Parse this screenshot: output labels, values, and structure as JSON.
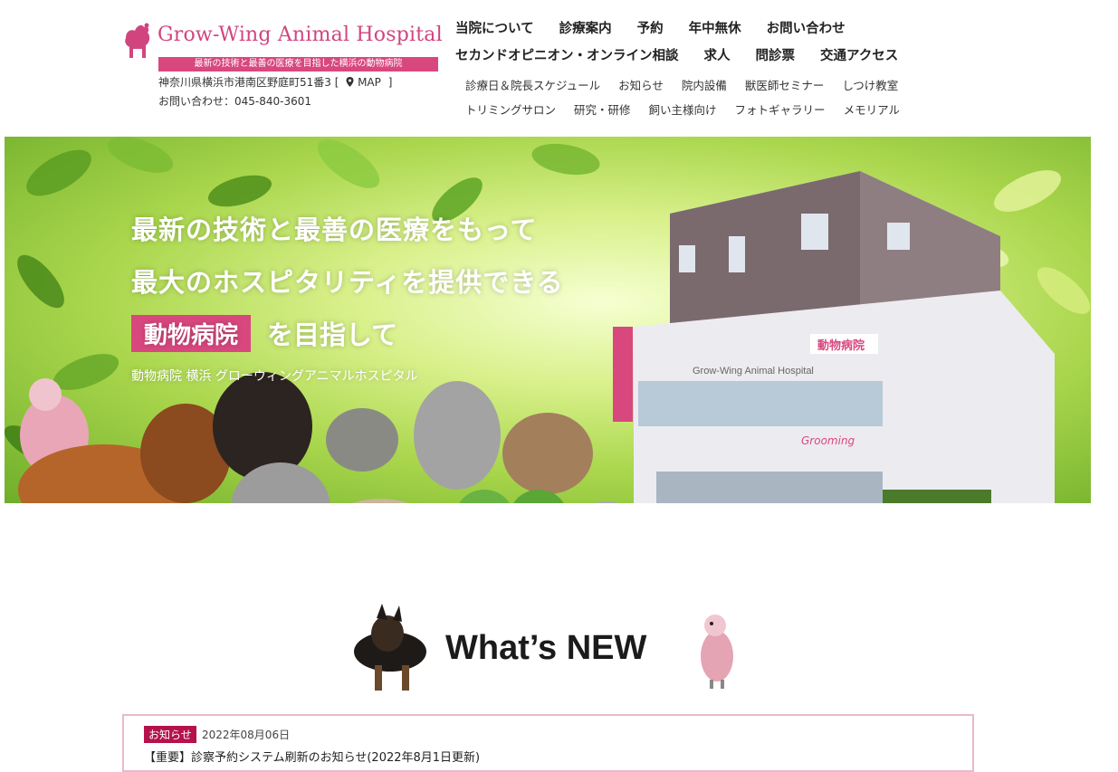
{
  "header": {
    "logo_title": "Grow-Wing Animal Hospital",
    "logo_tagline": "最新の技術と最善の医療を目指した横浜の動物病院",
    "address": "神奈川県横浜市港南区野庭町51番3",
    "map_bracket_open": "[",
    "map_label": "MAP",
    "map_bracket_close": "]",
    "phone": "お問い合わせ：045-840-3601"
  },
  "nav_main": {
    "row1": [
      "当院について",
      "診療案内",
      "予約",
      "年中無休",
      "お問い合わせ"
    ],
    "row2": [
      "セカンドオピニオン・オンライン相談",
      "求人",
      "問診票",
      "交通アクセス"
    ]
  },
  "nav_sub": {
    "row1": [
      "診療日＆院長スケジュール",
      "お知らせ",
      "院内設備",
      "獣医師セミナー",
      "しつけ教室"
    ],
    "row2": [
      "トリミングサロン",
      "研究・研修",
      "飼い主様向け",
      "フォトギャラリー",
      "メモリアル"
    ]
  },
  "hero": {
    "line1": "最新の技術と最善の医療をもって",
    "line2": "最大のホスピタリティを提供できる",
    "badge": "動物病院",
    "line3": "を目指して",
    "sub": "動物病院 横浜 グローウィングアニマルホスピタル",
    "building_sign": "Grow-Wing Animal Hospital",
    "building_sign_jp": "動物病院",
    "grooming_sign": "Grooming"
  },
  "whats_new": {
    "title": "What’s NEW"
  },
  "news": {
    "category": "お知らせ",
    "date": "2022年08月06日",
    "title": "【重要】診察予約システム刷新のお知らせ(2022年8月1日更新)"
  },
  "colors": {
    "brand_pink": "#d9477f",
    "news_cat": "#b5124c",
    "news_border": "#e8b9cc"
  }
}
